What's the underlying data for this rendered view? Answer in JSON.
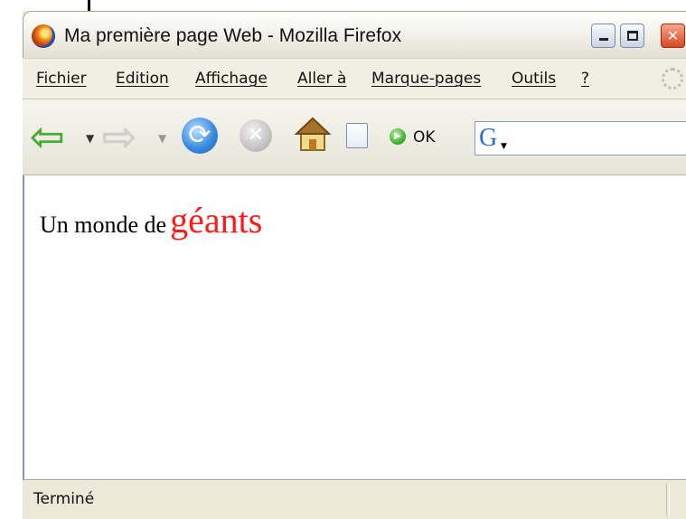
{
  "window": {
    "title": "Ma première page Web - Mozilla Firefox",
    "minimize_glyph": "",
    "close_glyph": "✕"
  },
  "menu": {
    "items": [
      {
        "label": "Fichier"
      },
      {
        "label": "Edition"
      },
      {
        "label": "Affichage"
      },
      {
        "label": "Aller à"
      },
      {
        "label": "Marque-pages"
      },
      {
        "label": "Outils"
      },
      {
        "label": "?"
      }
    ]
  },
  "toolbar": {
    "back_icon": "back-arrow-icon",
    "forward_icon": "forward-arrow-icon",
    "reload_icon": "reload-icon",
    "stop_icon": "stop-icon",
    "home_icon": "home-icon",
    "page_icon": "page-icon",
    "go_label": "OK",
    "search_engine_letter": "G"
  },
  "page": {
    "text_normal": "Un monde de",
    "text_big": "géants",
    "big_text_color": "#ff1a1a"
  },
  "status": {
    "text": "Terminé"
  }
}
